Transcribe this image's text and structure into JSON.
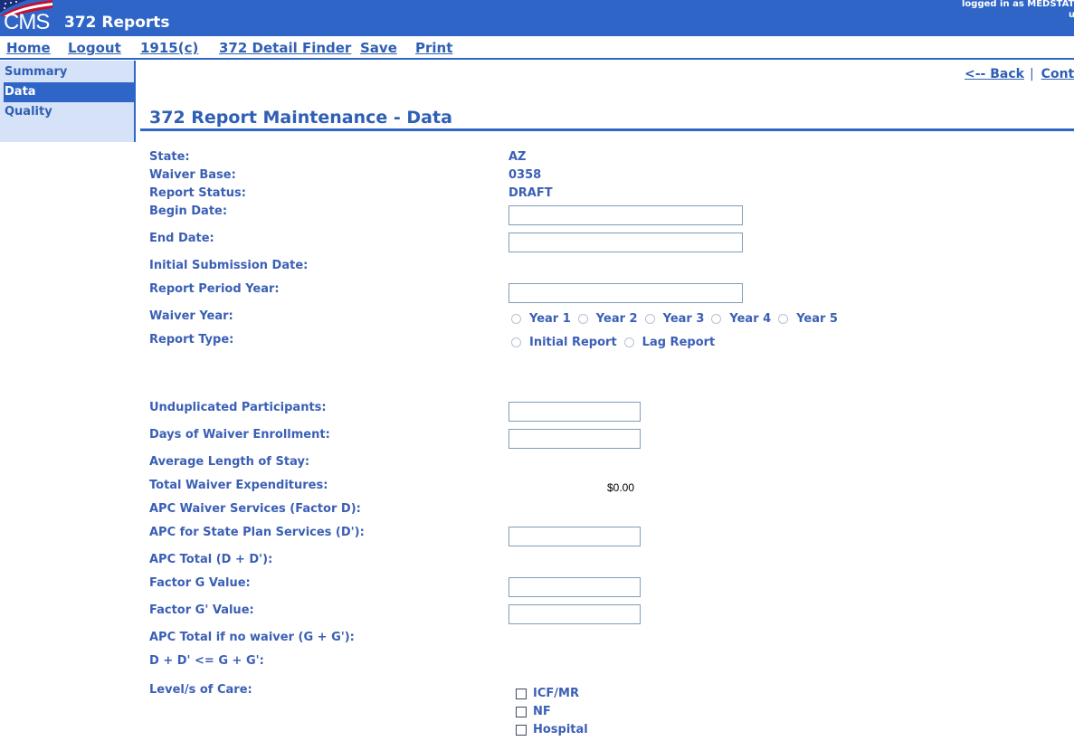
{
  "header": {
    "logo_text": "CMS",
    "app_title": "372 Reports",
    "login_text": "logged in as MEDSTAT",
    "login_text_2": "u"
  },
  "topnav": {
    "home": "Home",
    "logout": "Logout",
    "form_1915c": "1915(c)",
    "detail_finder": "372 Detail Finder",
    "save": "Save",
    "print": "Print"
  },
  "sidebar": {
    "items": [
      {
        "label": "Summary"
      },
      {
        "label": "Data"
      },
      {
        "label": "Quality"
      }
    ]
  },
  "backbar": {
    "back": "<-- Back",
    "separator": "|",
    "continue": "Cont"
  },
  "page_title": "372 Report Maintenance - Data",
  "fields": {
    "state_label": "State:",
    "state_value": "AZ",
    "waiver_base_label": "Waiver Base:",
    "waiver_base_value": "0358",
    "report_status_label": "Report Status:",
    "report_status_value": "DRAFT",
    "begin_date_label": "Begin Date:",
    "begin_date_value": "",
    "end_date_label": "End Date:",
    "end_date_value": "",
    "initial_submission_label": "Initial Submission Date:",
    "report_period_year_label": "Report Period Year:",
    "report_period_year_value": "",
    "waiver_year_label": "Waiver Year:",
    "waiver_year_options": [
      "Year 1",
      "Year 2",
      "Year 3",
      "Year 4",
      "Year 5"
    ],
    "report_type_label": "Report Type:",
    "report_type_options": [
      "Initial Report",
      "Lag Report"
    ],
    "unduplicated_label": "Unduplicated Participants:",
    "unduplicated_value": "",
    "days_enrollment_label": "Days of Waiver Enrollment:",
    "days_enrollment_value": "",
    "avg_stay_label": "Average Length of Stay:",
    "total_expenditures_label": "Total Waiver Expenditures:",
    "total_expenditures_value": "$0.00",
    "apc_waiver_label": "APC Waiver Services (Factor D):",
    "apc_state_plan_label": "APC for State Plan Services (D'):",
    "apc_state_plan_value": "",
    "apc_total_label": "APC Total (D + D'):",
    "factor_g_label": "Factor G Value:",
    "factor_g_value": "",
    "factor_g_prime_label": "Factor G' Value:",
    "factor_g_prime_value": "",
    "apc_no_waiver_label": "APC Total if no waiver (G + G'):",
    "comparison_label": "D + D' <= G + G':",
    "level_of_care_label": "Level/s of Care:",
    "level_of_care_options": [
      "ICF/MR",
      "NF",
      "Hospital"
    ]
  },
  "colors": {
    "banner": "#2f65c7",
    "text": "#3a5fb5",
    "sidebar_bg": "#d6e2f8"
  }
}
